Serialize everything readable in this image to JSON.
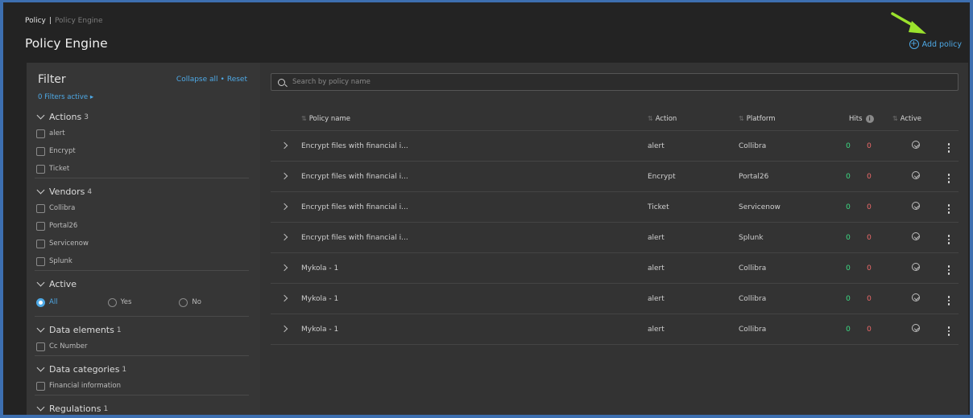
{
  "breadcrumb": {
    "root": "Policy",
    "separator": "|",
    "current": "Policy Engine"
  },
  "page_title": "Policy Engine",
  "add_policy": {
    "icon": "plus-circle-icon",
    "label": "Add policy"
  },
  "filter": {
    "title": "Filter",
    "collapse_all": "Collapse all",
    "separator": "•",
    "reset": "Reset",
    "filters_active": "0 Filters active",
    "filters_active_caret": "▸",
    "groups": [
      {
        "label": "Actions",
        "count": "3",
        "options": [
          "alert",
          "Encrypt",
          "Ticket"
        ]
      },
      {
        "label": "Vendors",
        "count": "4",
        "options": [
          "Collibra",
          "Portal26",
          "Servicenow",
          "Splunk"
        ]
      },
      {
        "label": "Active",
        "count": "",
        "radios": [
          {
            "label": "All",
            "selected": true
          },
          {
            "label": "Yes",
            "selected": false
          },
          {
            "label": "No",
            "selected": false
          }
        ]
      },
      {
        "label": "Data elements",
        "count": "1",
        "options": [
          "Cc Number"
        ]
      },
      {
        "label": "Data categories",
        "count": "1",
        "options": [
          "Financial information"
        ]
      },
      {
        "label": "Regulations",
        "count": "1",
        "options": []
      }
    ]
  },
  "search": {
    "placeholder": "Search by policy name"
  },
  "table": {
    "sort_icon": "⇅",
    "columns": {
      "name": "Policy name",
      "action": "Action",
      "platform": "Platform",
      "hits": "Hits",
      "active": "Active"
    },
    "rows": [
      {
        "name": "Encrypt files with financial i...",
        "action": "alert",
        "platform": "Collibra",
        "hits_ok": "0",
        "hits_bad": "0"
      },
      {
        "name": "Encrypt files with financial i...",
        "action": "Encrypt",
        "platform": "Portal26",
        "hits_ok": "0",
        "hits_bad": "0"
      },
      {
        "name": "Encrypt files with financial i...",
        "action": "Ticket",
        "platform": "Servicenow",
        "hits_ok": "0",
        "hits_bad": "0"
      },
      {
        "name": "Encrypt files with financial i...",
        "action": "alert",
        "platform": "Splunk",
        "hits_ok": "0",
        "hits_bad": "0"
      },
      {
        "name": "Mykola - 1",
        "action": "alert",
        "platform": "Collibra",
        "hits_ok": "0",
        "hits_bad": "0"
      },
      {
        "name": "Mykola - 1",
        "action": "alert",
        "platform": "Collibra",
        "hits_ok": "0",
        "hits_bad": "0"
      },
      {
        "name": "Mykola - 1",
        "action": "alert",
        "platform": "Collibra",
        "hits_ok": "0",
        "hits_bad": "0"
      }
    ]
  },
  "colors": {
    "accent": "#4ea9e6",
    "ok": "#3ddc84",
    "bad": "#f06a6a",
    "annotation_arrow": "#9be22d"
  }
}
